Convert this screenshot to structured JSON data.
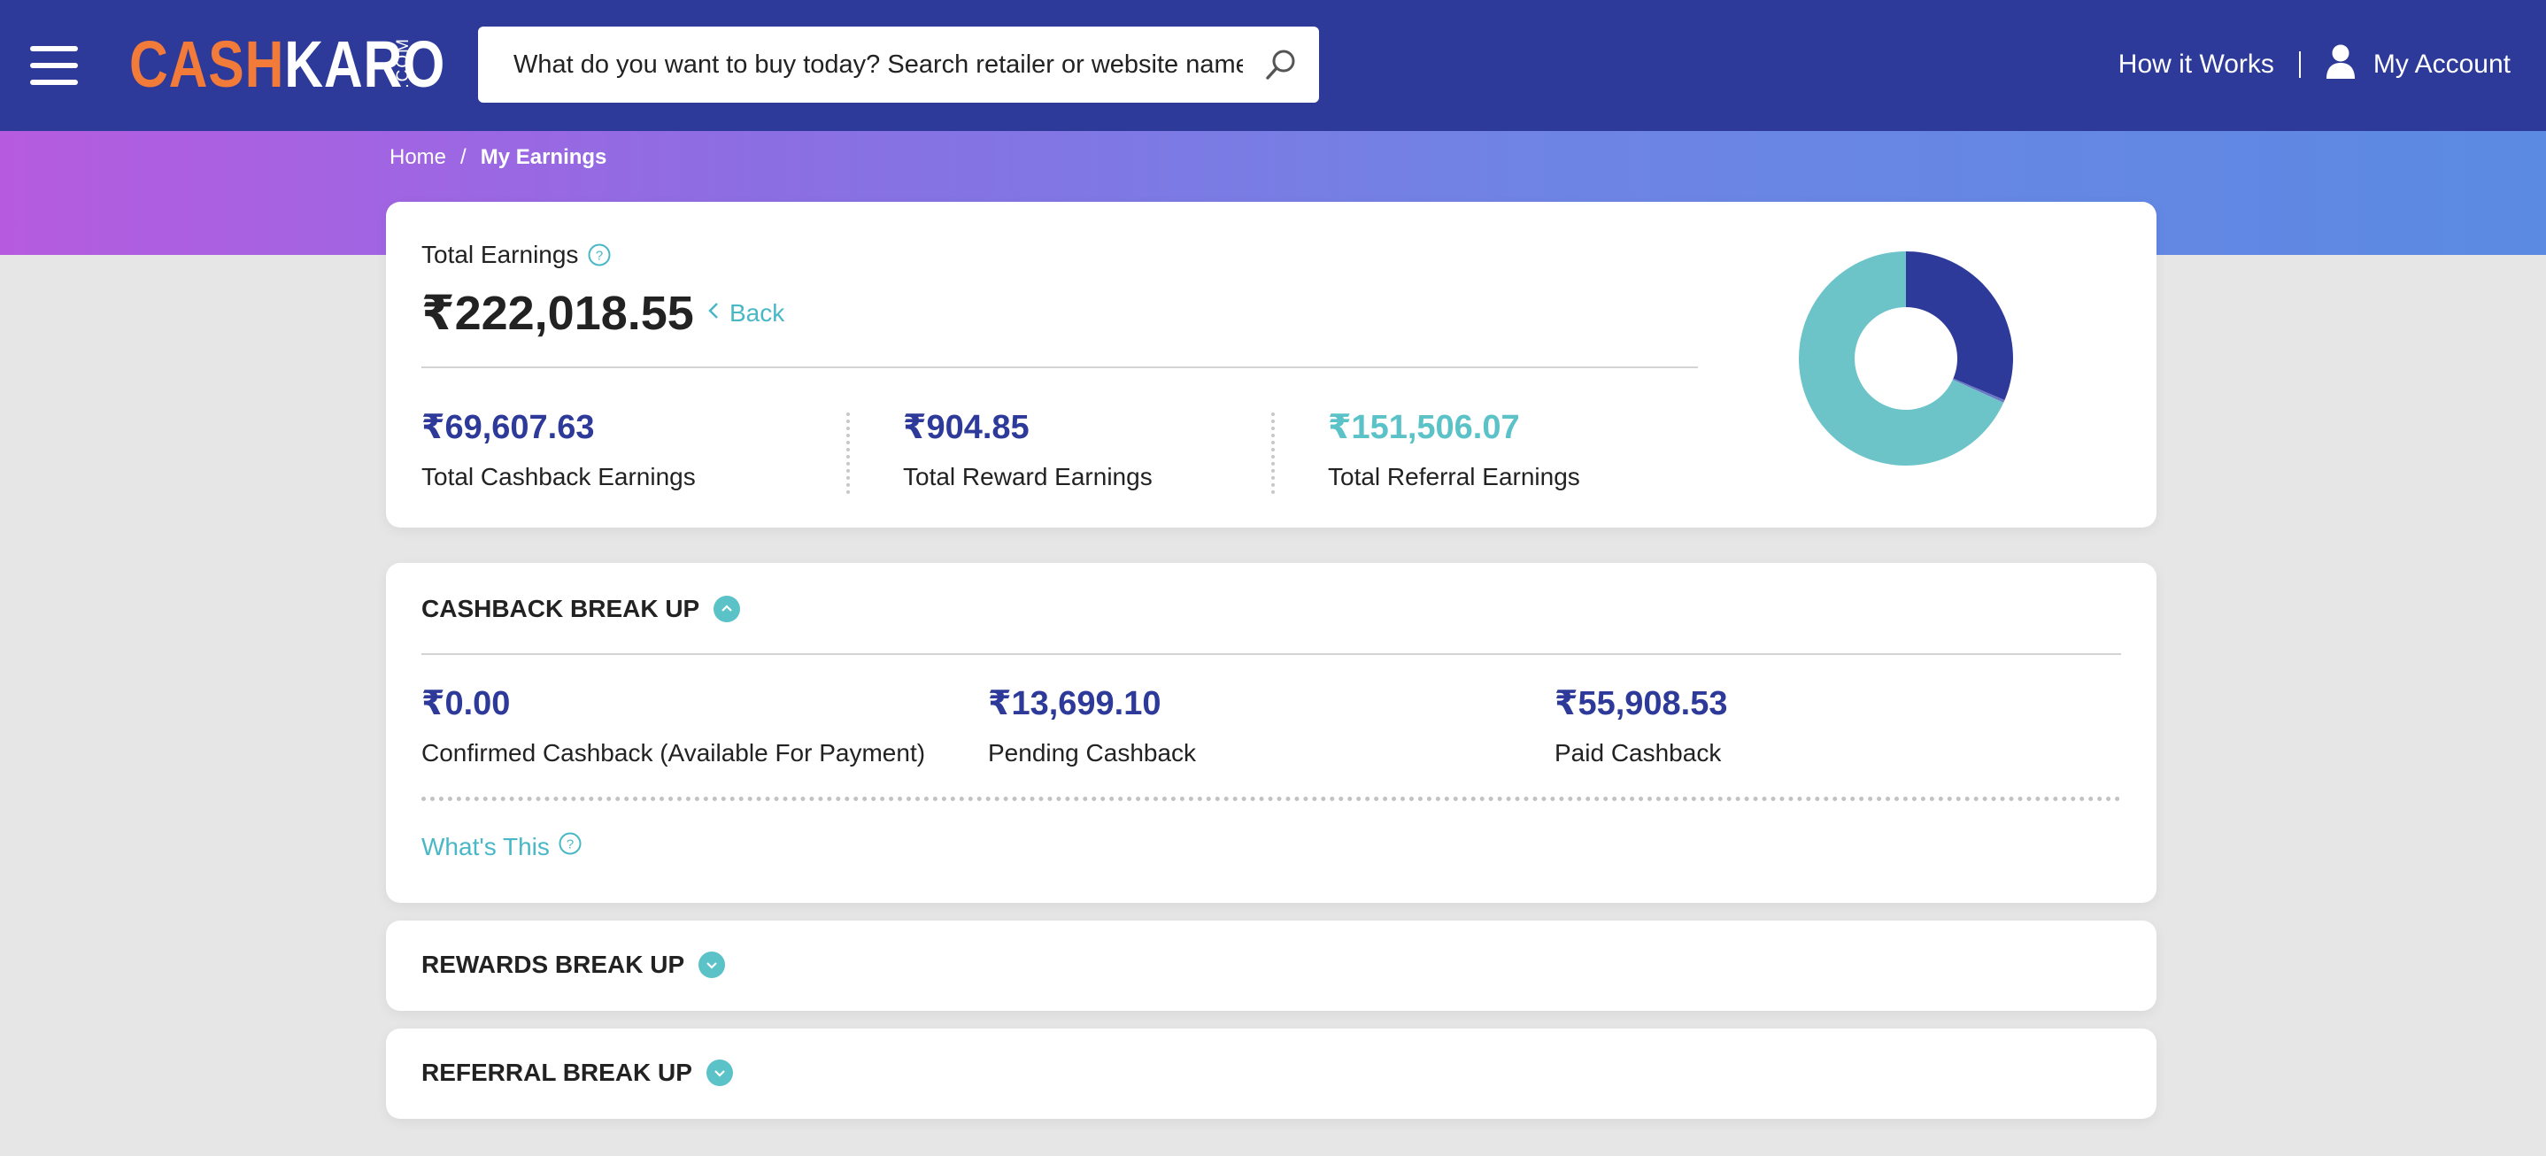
{
  "header": {
    "logo_cash": "CASH",
    "logo_karo": "KARO",
    "logo_com": ".COM",
    "search_placeholder": "What do you want to buy today? Search retailer or website name",
    "how_it_works": "How it Works",
    "my_account": "My Account"
  },
  "breadcrumb": {
    "home": "Home",
    "separator": "/",
    "current": "My Earnings"
  },
  "summary": {
    "title": "Total Earnings",
    "total": "₹222,018.55",
    "back_label": "Back",
    "stats": [
      {
        "value": "₹69,607.63",
        "label": "Total Cashback Earnings"
      },
      {
        "value": "₹904.85",
        "label": "Total Reward Earnings"
      },
      {
        "value": "₹151,506.07",
        "label": "Total Referral Earnings"
      }
    ]
  },
  "chart_data": {
    "type": "pie",
    "donut": true,
    "categories": [
      "Total Cashback Earnings",
      "Total Reward Earnings",
      "Total Referral Earnings"
    ],
    "values": [
      69607.63,
      904.85,
      151506.07
    ],
    "colors": [
      "#2e3a9a",
      "#6b77c4",
      "#6cc4c9"
    ]
  },
  "cashback_breakup": {
    "title": "CASHBACK BREAK UP",
    "items": [
      {
        "value": "₹0.00",
        "label": "Confirmed Cashback (Available For Payment)"
      },
      {
        "value": "₹13,699.10",
        "label": "Pending Cashback"
      },
      {
        "value": "₹55,908.53",
        "label": "Paid Cashback"
      }
    ],
    "whats_this": "What's This"
  },
  "rewards_breakup": {
    "title": "REWARDS BREAK UP"
  },
  "referral_breakup": {
    "title": "REFERRAL BREAK UP"
  },
  "colors": {
    "nav_bg": "#2e3a9a",
    "accent_teal": "#5bc2c8",
    "logo_orange": "#f27b3a"
  }
}
